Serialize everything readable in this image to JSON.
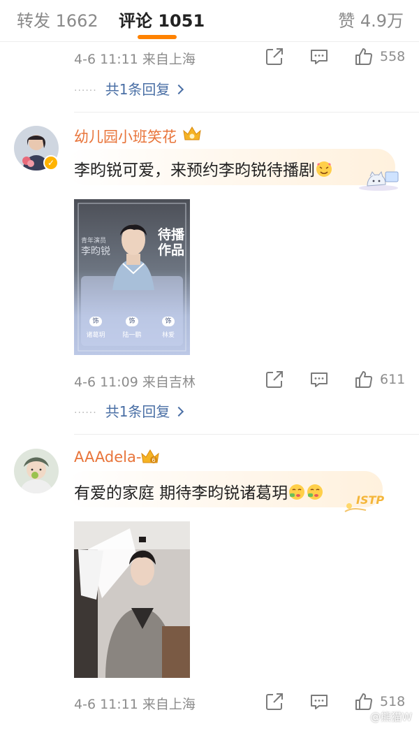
{
  "tabs": {
    "repost": "转发 1662",
    "comment": "评论 1051",
    "like": "赞 4.9万"
  },
  "comments": [
    {
      "meta": {
        "time_location": "4-6 11:11  来自上海",
        "like_count": "558"
      },
      "reply_link": "共1条回复"
    },
    {
      "username": "幼儿园小班笑花",
      "text": "李昀锐可爱，来预约李昀锐待播剧",
      "poster": {
        "side_text": "待播作品",
        "actor_label": "青年演员",
        "actor_name": "李昀锐",
        "roles": [
          "诸葛玥",
          "陆一鹏",
          "林爱"
        ],
        "role_tags": [
          "饰",
          "饰",
          "饰"
        ]
      },
      "meta": {
        "time_location": "4-6 11:09  来自吉林",
        "like_count": "611"
      },
      "reply_link": "共1条回复"
    },
    {
      "username": "AAAdela-",
      "crown_level": "6",
      "deco_text": "ISTP",
      "text": "有爱的家庭 期待李昀锐诸葛玥",
      "meta": {
        "time_location": "4-6 11:11  来自上海",
        "like_count": "518"
      }
    }
  ],
  "watermark": "@熊猫W",
  "colors": {
    "accent": "#ff8200",
    "username": "#e8743a",
    "link": "#4a6fa5",
    "meta": "#8c8c8c"
  },
  "icons": [
    "share-icon",
    "comment-icon",
    "like-icon",
    "chevron-right-icon",
    "crown-badge-icon",
    "verified-icon"
  ]
}
